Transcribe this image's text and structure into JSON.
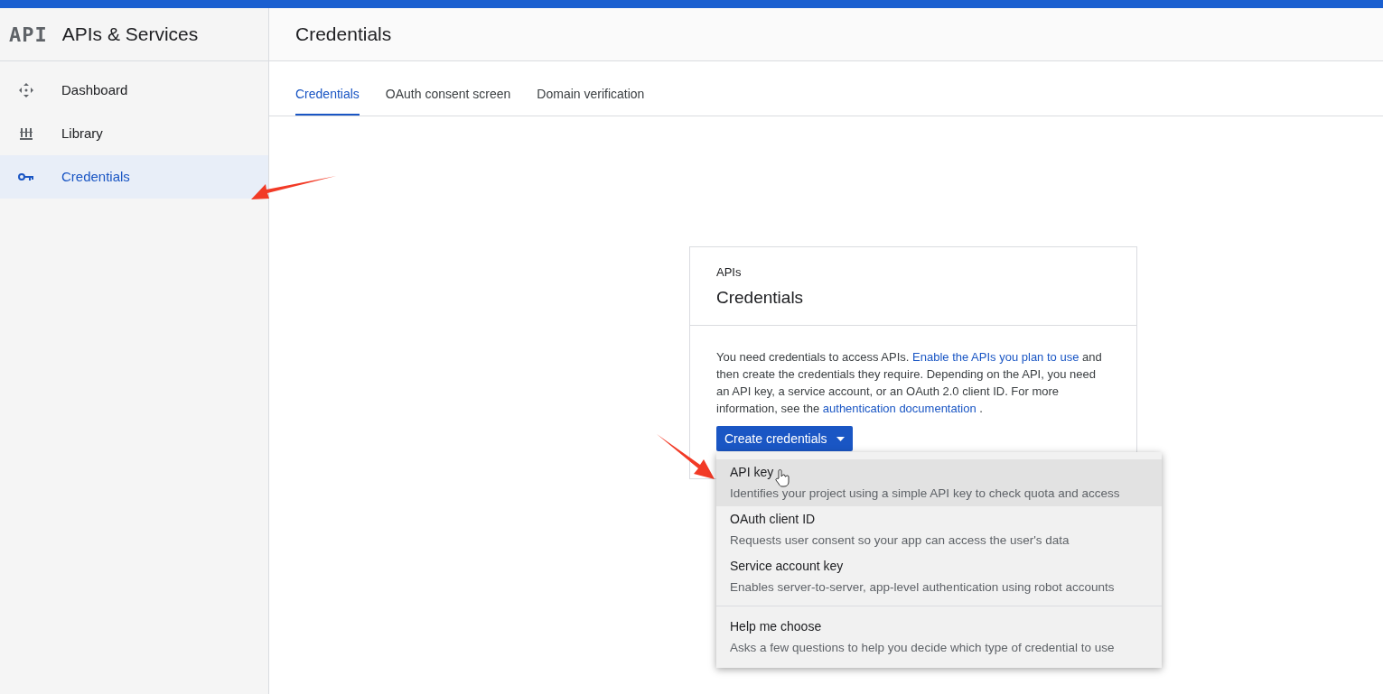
{
  "sidebar": {
    "logo": "API",
    "title": "APIs & Services",
    "items": [
      {
        "label": "Dashboard",
        "kind": "dashboard",
        "selected": false
      },
      {
        "label": "Library",
        "kind": "library",
        "selected": false
      },
      {
        "label": "Credentials",
        "kind": "key",
        "selected": true
      }
    ]
  },
  "header": {
    "title": "Credentials"
  },
  "tabs": [
    {
      "label": "Credentials",
      "selected": true
    },
    {
      "label": "OAuth consent screen",
      "selected": false
    },
    {
      "label": "Domain verification",
      "selected": false
    }
  ],
  "card": {
    "eyebrow": "APIs",
    "title": "Credentials",
    "paragraph": [
      {
        "text": "You need credentials to access APIs.",
        "link": false
      },
      {
        "text": "Enable the APIs you plan to use",
        "link": true
      },
      {
        "text": "and then create the credentials they require. Depending on the API, you need an API key, a service account, or an OAuth 2.0 client ID. For more information, see the",
        "link": false
      },
      {
        "text": "authentication documentation",
        "link": true
      },
      {
        "text": ".",
        "link": false
      }
    ],
    "button": "Create credentials"
  },
  "menu": {
    "groups": [
      [
        {
          "title": "API key",
          "description": "Identifies your project using a simple API key to check quota and access",
          "selected": true
        },
        {
          "title": "OAuth client ID",
          "description": "Requests user consent so your app can access the user's data",
          "selected": false
        },
        {
          "title": "Service account key",
          "description": "Enables server-to-server, app-level authentication using robot accounts",
          "selected": false
        }
      ],
      [
        {
          "title": "Help me choose",
          "description": "Asks a few questions to help you decide which type of credential to use",
          "selected": false
        }
      ]
    ]
  }
}
